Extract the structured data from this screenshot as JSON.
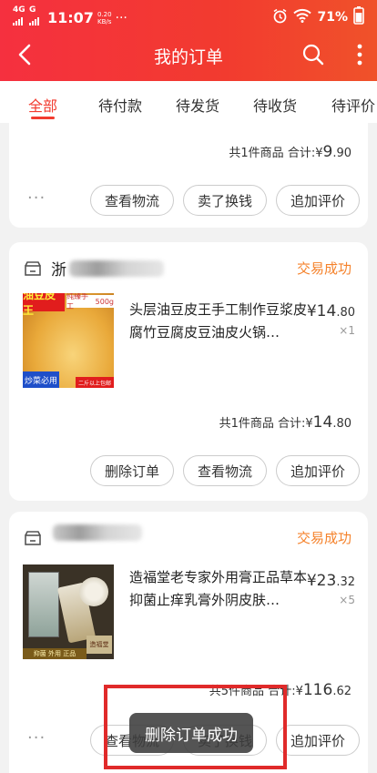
{
  "status_bar": {
    "network": "4G",
    "network2": "G",
    "time": "11:07",
    "speed_value": "0.20",
    "speed_unit": "KB/s",
    "battery": "71%"
  },
  "header": {
    "title": "我的订单"
  },
  "tabs": [
    "全部",
    "待付款",
    "待发货",
    "待收货",
    "待评价"
  ],
  "orders": [
    {
      "summary": {
        "count_text": "共1件商品",
        "total_label": "合计:",
        "currency": "¥",
        "total_int": "9",
        "total_dec": ".90"
      },
      "buttons": [
        "查看物流",
        "卖了换钱",
        "追加评价"
      ],
      "dots": "···"
    },
    {
      "shop_name": "浙",
      "status": "交易成功",
      "item": {
        "title": "头层油豆皮王手工制作豆浆皮腐竹豆腐皮豆油皮火锅…",
        "currency": "¥",
        "price_int": "14",
        "price_dec": ".80",
        "qty": "×1",
        "img": {
          "brand": "油豆皮王",
          "tag": "纯臻手工",
          "weight": "500g",
          "corner": "炒菜必用",
          "note": "二斤以上包邮"
        }
      },
      "summary": {
        "count_text": "共1件商品",
        "total_label": "合计:",
        "currency": "¥",
        "total_int": "14",
        "total_dec": ".80"
      },
      "buttons": [
        "删除订单",
        "查看物流",
        "追加评价"
      ]
    },
    {
      "status": "交易成功",
      "item": {
        "title": "造福堂老专家外用膏正品草本抑菌止痒乳膏外阴皮肤…",
        "currency": "¥",
        "price_int": "23",
        "price_dec": ".32",
        "qty": "×5",
        "img": {
          "label_bottom": "抑菌 外用 正品",
          "side_label": "造福堂"
        }
      },
      "summary": {
        "count_text": "共5件商品",
        "total_label": "合计:",
        "currency": "¥",
        "total_int": "116",
        "total_dec": ".62"
      },
      "buttons": [
        "查看物流",
        "卖了换钱",
        "追加评价"
      ],
      "dots": "···"
    }
  ],
  "toast": "删除订单成功",
  "colors": {
    "accent": "#f23b2f",
    "status": "#f5822b",
    "highlight_box": "#e02a2a"
  }
}
